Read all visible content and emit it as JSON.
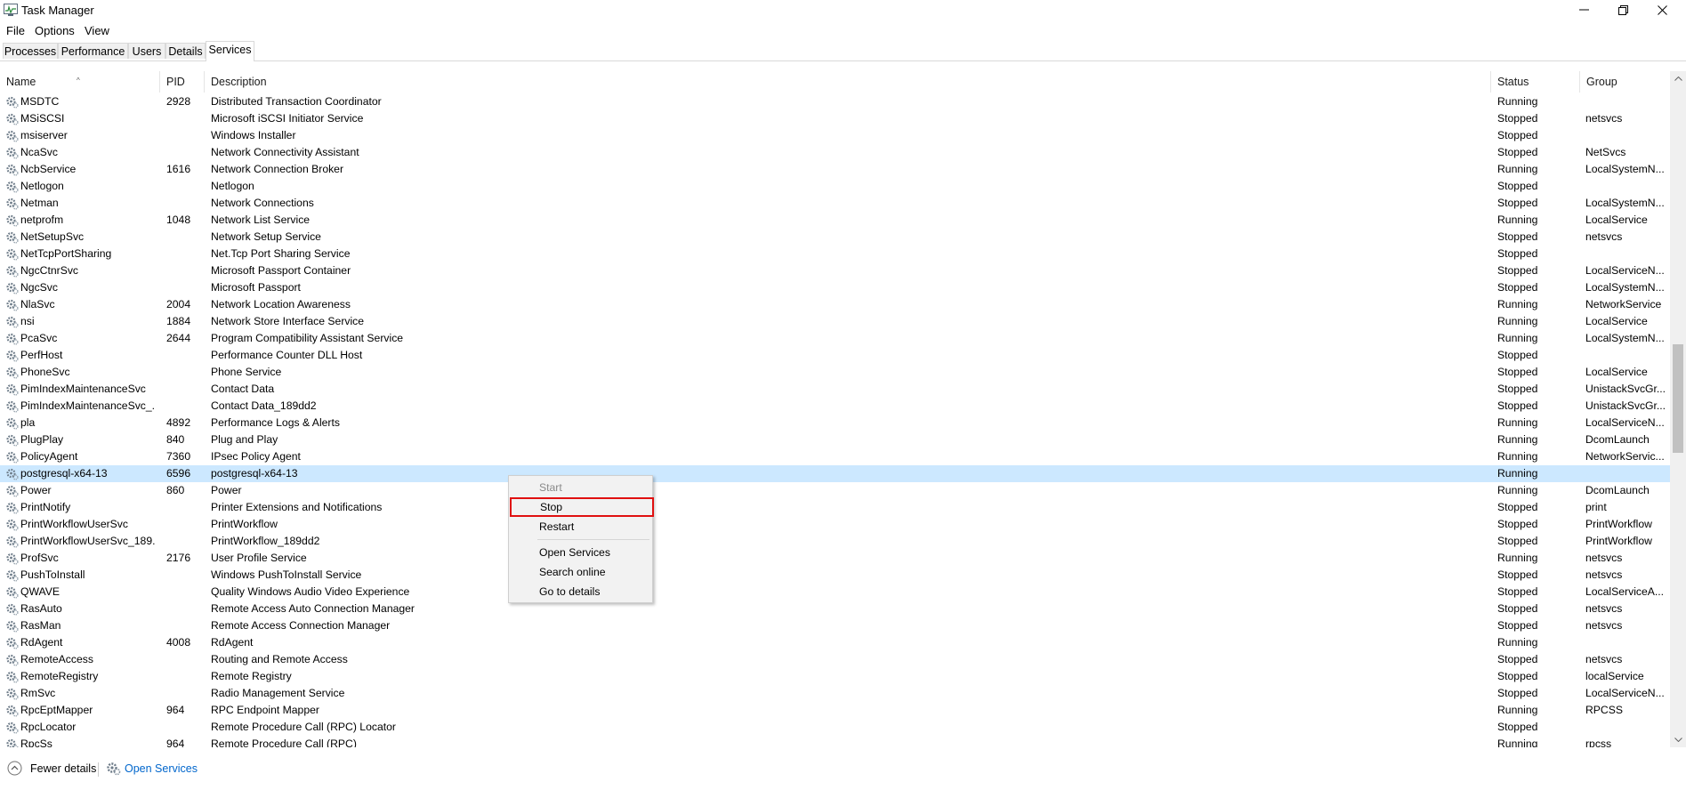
{
  "window": {
    "title": "Task Manager"
  },
  "menu": [
    "File",
    "Options",
    "View"
  ],
  "tabs": [
    {
      "label": "Processes"
    },
    {
      "label": "Performance"
    },
    {
      "label": "Users"
    },
    {
      "label": "Details"
    },
    {
      "label": "Services",
      "active": true
    }
  ],
  "columns": {
    "name": "Name",
    "pid": "PID",
    "description": "Description",
    "status": "Status",
    "group": "Group"
  },
  "rows": [
    {
      "name": "MSDTC",
      "pid": "2928",
      "description": "Distributed Transaction Coordinator",
      "status": "Running",
      "group": ""
    },
    {
      "name": "MSiSCSI",
      "pid": "",
      "description": "Microsoft iSCSI Initiator Service",
      "status": "Stopped",
      "group": "netsvcs"
    },
    {
      "name": "msiserver",
      "pid": "",
      "description": "Windows Installer",
      "status": "Stopped",
      "group": ""
    },
    {
      "name": "NcaSvc",
      "pid": "",
      "description": "Network Connectivity Assistant",
      "status": "Stopped",
      "group": "NetSvcs"
    },
    {
      "name": "NcbService",
      "pid": "1616",
      "description": "Network Connection Broker",
      "status": "Running",
      "group": "LocalSystemN..."
    },
    {
      "name": "Netlogon",
      "pid": "",
      "description": "Netlogon",
      "status": "Stopped",
      "group": ""
    },
    {
      "name": "Netman",
      "pid": "",
      "description": "Network Connections",
      "status": "Stopped",
      "group": "LocalSystemN..."
    },
    {
      "name": "netprofm",
      "pid": "1048",
      "description": "Network List Service",
      "status": "Running",
      "group": "LocalService"
    },
    {
      "name": "NetSetupSvc",
      "pid": "",
      "description": "Network Setup Service",
      "status": "Stopped",
      "group": "netsvcs"
    },
    {
      "name": "NetTcpPortSharing",
      "pid": "",
      "description": "Net.Tcp Port Sharing Service",
      "status": "Stopped",
      "group": ""
    },
    {
      "name": "NgcCtnrSvc",
      "pid": "",
      "description": "Microsoft Passport Container",
      "status": "Stopped",
      "group": "LocalServiceN..."
    },
    {
      "name": "NgcSvc",
      "pid": "",
      "description": "Microsoft Passport",
      "status": "Stopped",
      "group": "LocalSystemN..."
    },
    {
      "name": "NlaSvc",
      "pid": "2004",
      "description": "Network Location Awareness",
      "status": "Running",
      "group": "NetworkService"
    },
    {
      "name": "nsi",
      "pid": "1884",
      "description": "Network Store Interface Service",
      "status": "Running",
      "group": "LocalService"
    },
    {
      "name": "PcaSvc",
      "pid": "2644",
      "description": "Program Compatibility Assistant Service",
      "status": "Running",
      "group": "LocalSystemN..."
    },
    {
      "name": "PerfHost",
      "pid": "",
      "description": "Performance Counter DLL Host",
      "status": "Stopped",
      "group": ""
    },
    {
      "name": "PhoneSvc",
      "pid": "",
      "description": "Phone Service",
      "status": "Stopped",
      "group": "LocalService"
    },
    {
      "name": "PimIndexMaintenanceSvc",
      "pid": "",
      "description": "Contact Data",
      "status": "Stopped",
      "group": "UnistackSvcGr..."
    },
    {
      "name": "PimIndexMaintenanceSvc_...",
      "pid": "",
      "description": "Contact Data_189dd2",
      "status": "Stopped",
      "group": "UnistackSvcGr..."
    },
    {
      "name": "pla",
      "pid": "4892",
      "description": "Performance Logs & Alerts",
      "status": "Running",
      "group": "LocalServiceN..."
    },
    {
      "name": "PlugPlay",
      "pid": "840",
      "description": "Plug and Play",
      "status": "Running",
      "group": "DcomLaunch"
    },
    {
      "name": "PolicyAgent",
      "pid": "7360",
      "description": "IPsec Policy Agent",
      "status": "Running",
      "group": "NetworkServic..."
    },
    {
      "name": "postgresql-x64-13",
      "pid": "6596",
      "description": "postgresql-x64-13",
      "status": "Running",
      "group": "",
      "selected": true
    },
    {
      "name": "Power",
      "pid": "860",
      "description": "Power",
      "status": "Running",
      "group": "DcomLaunch"
    },
    {
      "name": "PrintNotify",
      "pid": "",
      "description": "Printer Extensions and Notifications",
      "status": "Stopped",
      "group": "print"
    },
    {
      "name": "PrintWorkflowUserSvc",
      "pid": "",
      "description": "PrintWorkflow",
      "status": "Stopped",
      "group": "PrintWorkflow"
    },
    {
      "name": "PrintWorkflowUserSvc_189...",
      "pid": "",
      "description": "PrintWorkflow_189dd2",
      "status": "Stopped",
      "group": "PrintWorkflow"
    },
    {
      "name": "ProfSvc",
      "pid": "2176",
      "description": "User Profile Service",
      "status": "Running",
      "group": "netsvcs"
    },
    {
      "name": "PushToInstall",
      "pid": "",
      "description": "Windows PushToInstall Service",
      "status": "Stopped",
      "group": "netsvcs"
    },
    {
      "name": "QWAVE",
      "pid": "",
      "description": "Quality Windows Audio Video Experience",
      "status": "Stopped",
      "group": "LocalServiceA..."
    },
    {
      "name": "RasAuto",
      "pid": "",
      "description": "Remote Access Auto Connection Manager",
      "status": "Stopped",
      "group": "netsvcs"
    },
    {
      "name": "RasMan",
      "pid": "",
      "description": "Remote Access Connection Manager",
      "status": "Stopped",
      "group": "netsvcs"
    },
    {
      "name": "RdAgent",
      "pid": "4008",
      "description": "RdAgent",
      "status": "Running",
      "group": ""
    },
    {
      "name": "RemoteAccess",
      "pid": "",
      "description": "Routing and Remote Access",
      "status": "Stopped",
      "group": "netsvcs"
    },
    {
      "name": "RemoteRegistry",
      "pid": "",
      "description": "Remote Registry",
      "status": "Stopped",
      "group": "localService"
    },
    {
      "name": "RmSvc",
      "pid": "",
      "description": "Radio Management Service",
      "status": "Stopped",
      "group": "LocalServiceN..."
    },
    {
      "name": "RpcEptMapper",
      "pid": "964",
      "description": "RPC Endpoint Mapper",
      "status": "Running",
      "group": "RPCSS"
    },
    {
      "name": "RpcLocator",
      "pid": "",
      "description": "Remote Procedure Call (RPC) Locator",
      "status": "Stopped",
      "group": ""
    },
    {
      "name": "RpcSs",
      "pid": "964",
      "description": "Remote Procedure Call (RPC)",
      "status": "Running",
      "group": "rpcss"
    }
  ],
  "context_menu": {
    "items": [
      {
        "label": "Start",
        "disabled": true
      },
      {
        "label": "Stop",
        "highlighted": true
      },
      {
        "label": "Restart"
      },
      {
        "label": "Open Services"
      },
      {
        "label": "Search online"
      },
      {
        "label": "Go to details"
      }
    ]
  },
  "footer": {
    "fewer_details": "Fewer details",
    "open_services": "Open Services"
  },
  "icons": {
    "app": "task-manager-icon",
    "service": "gear-service-icon",
    "fewer": "chevron-up-circle-icon",
    "open_services": "services-gear-icon"
  },
  "colors": {
    "selection": "#cce8ff",
    "highlight_box": "#e01010",
    "link": "#0066cc"
  }
}
